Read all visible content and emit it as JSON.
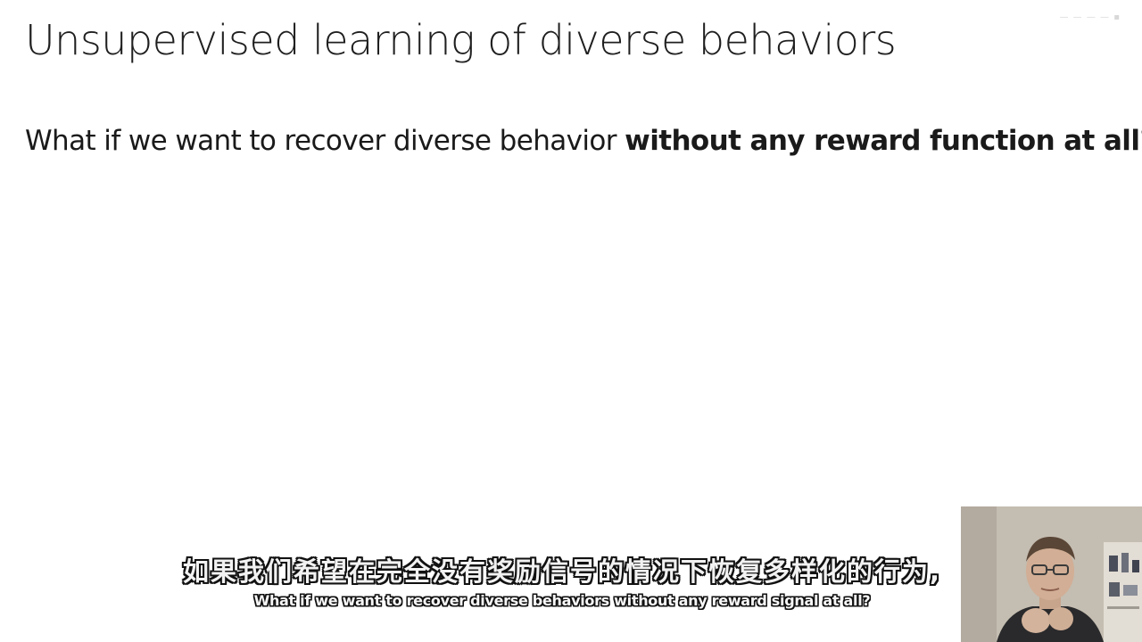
{
  "slide": {
    "title": "Unsupervised learning of diverse behaviors",
    "body_prefix": "What if we want to recover diverse behavior ",
    "body_bold": "without any reward function at all",
    "body_suffix": "?",
    "corner_mark": "— — — — ▪"
  },
  "subtitles": {
    "chinese": "如果我们希望在完全没有奖励信号的情况下恢复多样化的行为,",
    "english": "What if we want to recover diverse behaviors without any reward signal at all?"
  },
  "webcam": {
    "icon": "presenter-video-icon"
  },
  "colors": {
    "background": "#ffffff",
    "text": "#1f1f1f",
    "subtitle_fill": "#f2f2f2",
    "subtitle_outline": "#111111"
  }
}
